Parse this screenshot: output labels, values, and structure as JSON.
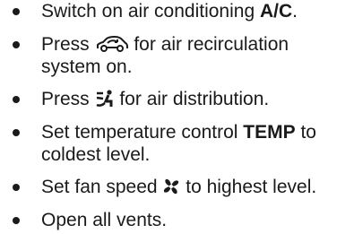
{
  "items": [
    {
      "pre": "Switch on air conditioning ",
      "control": "A/C",
      "post": "."
    },
    {
      "pre": "Press ",
      "icon": "car-recirculation-icon",
      "post": " for air recirculation",
      "line2": "system on."
    },
    {
      "pre": "Press ",
      "icon": "air-distribution-icon",
      "post": " for air distribution."
    },
    {
      "pre": "Set temperature control ",
      "control": "TEMP",
      "post": " to",
      "line2": "coldest level."
    },
    {
      "pre": "Set fan speed ",
      "icon": "fan-icon",
      "post": " to highest level."
    },
    {
      "pre": "Open all vents."
    }
  ]
}
